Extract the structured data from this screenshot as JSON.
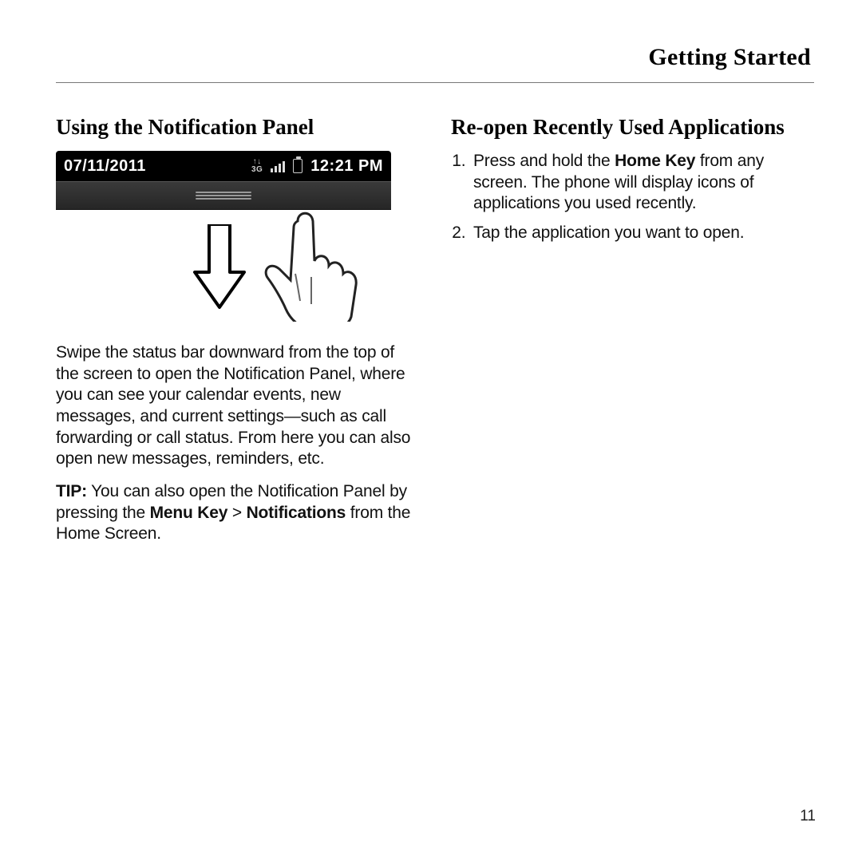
{
  "chapter": "Getting Started",
  "left": {
    "heading": "Using the Notification Panel",
    "statusbar": {
      "date": "07/11/2011",
      "network": "3G",
      "time": "12:21 PM"
    },
    "paragraph": "Swipe the status bar downward from the top of the screen to open the Notification Panel, where you can see your calendar events, new messages, and current settings—such as call forwarding or call status. From here you can also open new messages, reminders, etc.",
    "tip_label": "TIP:",
    "tip_before": " You can also open the Notification Panel by pressing the ",
    "tip_menu_key": "Menu Key",
    "tip_gt": " > ",
    "tip_notifications": "Notifications",
    "tip_after": " from the Home Screen."
  },
  "right": {
    "heading": "Re-open Recently Used Applications",
    "step1_before": "Press and hold the ",
    "step1_bold": "Home Key",
    "step1_after": " from any screen. The phone will display icons of applications you used recently.",
    "step2": "Tap the application you want to open."
  },
  "page_number": "11"
}
